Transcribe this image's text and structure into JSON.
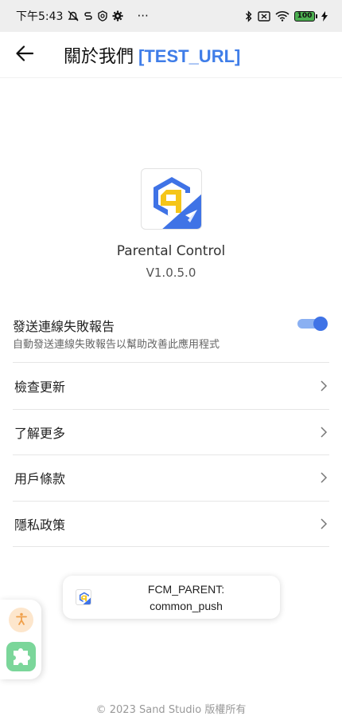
{
  "status_bar": {
    "time": "下午5:43",
    "dots": "···",
    "battery": "100"
  },
  "app_bar": {
    "title": "關於我們",
    "url_tag": "[TEST_URL]"
  },
  "about": {
    "app_name": "Parental Control",
    "version": "V1.0.5.0"
  },
  "report": {
    "title": "發送連線失敗報告",
    "subtitle": "自動發送連線失敗報告以幫助改善此應用程式",
    "enabled": true
  },
  "menu": [
    {
      "label": "檢查更新"
    },
    {
      "label": "了解更多"
    },
    {
      "label": "用戶條款"
    },
    {
      "label": "隱私政策"
    }
  ],
  "toast": {
    "line1": "FCM_PARENT:",
    "line2": "common_push"
  },
  "footer": {
    "copyright": "© 2023 Sand Studio 版權所有"
  },
  "colors": {
    "accent": "#3f73e6",
    "logo_yellow": "#f5c518",
    "logo_blue": "#3f73e6"
  }
}
